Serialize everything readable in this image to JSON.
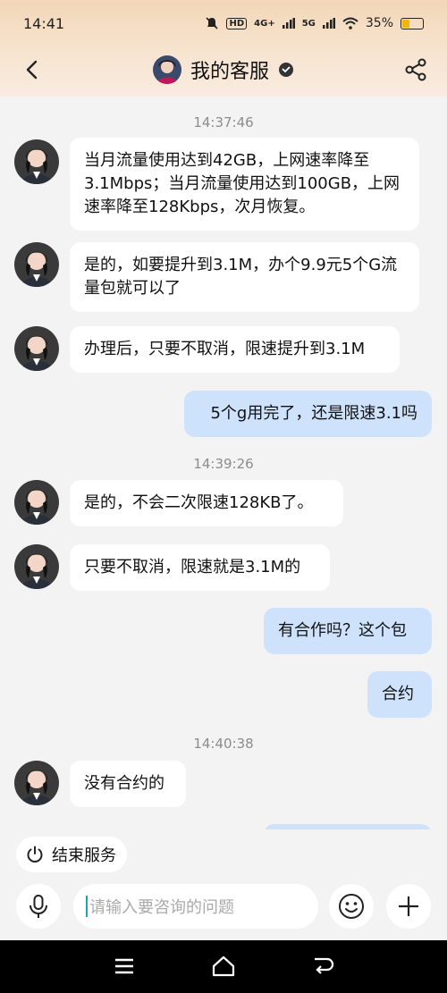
{
  "status": {
    "time": "14:41",
    "net1": "4G+",
    "net2": "5G",
    "battery": "35%",
    "battery_level": 0.35
  },
  "header": {
    "title": "我的客服"
  },
  "messages": [
    {
      "kind": "time",
      "text": "14:37:46"
    },
    {
      "kind": "in",
      "text": "当月流量使用达到42GB，上网速率降至3.1Mbps；当月流量使用达到100GB，上网速率降至128Kbps，次月恢复。"
    },
    {
      "kind": "in",
      "text": "是的，如要提升到3.1M，办个9.9元5个G流量包就可以了"
    },
    {
      "kind": "in",
      "text": "办理后，只要不取消，限速提升到3.1M"
    },
    {
      "kind": "out",
      "text": "5个g用完了，还是限速3.1吗"
    },
    {
      "kind": "time",
      "text": "14:39:26"
    },
    {
      "kind": "in",
      "text": "是的，不会二次限速128KB了。"
    },
    {
      "kind": "in",
      "text": "只要不取消，限速就是3.1M的"
    },
    {
      "kind": "out",
      "text": "有合作吗？这个包"
    },
    {
      "kind": "out",
      "text": "合约"
    },
    {
      "kind": "time",
      "text": "14:40:38"
    },
    {
      "kind": "in",
      "text": "没有合约的"
    }
  ],
  "actions": {
    "end_service": "结束服务"
  },
  "input": {
    "placeholder": "请输入要咨询的问题"
  },
  "icons": {
    "back": "chevron-left-icon",
    "share": "share-icon",
    "verified": "verified-badge-icon",
    "power": "power-icon",
    "mic": "microphone-icon",
    "emoji": "emoji-icon",
    "plus": "plus-icon",
    "menu": "menu-icon",
    "home": "home-icon",
    "return": "return-icon"
  },
  "colors": {
    "incoming_bubble": "#ffffff",
    "outgoing_bubble": "#cfe2fb",
    "header_gradient_top": "#f2d7b8",
    "caret": "#18a8a8"
  }
}
